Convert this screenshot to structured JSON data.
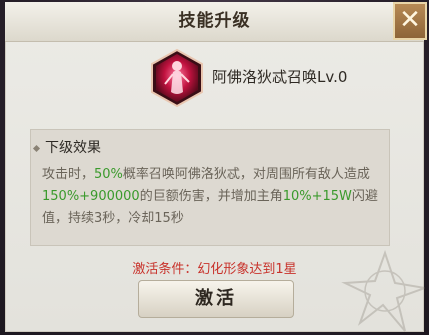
{
  "dialog": {
    "title": "技能升级",
    "close_icon": "close-icon"
  },
  "skill": {
    "icon": "summon-figure-icon",
    "name": "阿佛洛狄忒召唤Lv.0"
  },
  "next_effect": {
    "header": "下级效果",
    "text_parts": [
      "攻击时，",
      "50%",
      "概率召唤阿佛洛狄忒，对周围所有敌人造成",
      "150%+900000",
      "的巨额伤害，并增加主角",
      "10%+15W",
      "闪避值，持续3秒，冷却15秒"
    ]
  },
  "activation": {
    "condition": "激活条件：幻化形象达到1星",
    "button_label": "激活"
  },
  "colors": {
    "highlight_green": "#3a9a2c",
    "condition_red": "#c8322b"
  }
}
